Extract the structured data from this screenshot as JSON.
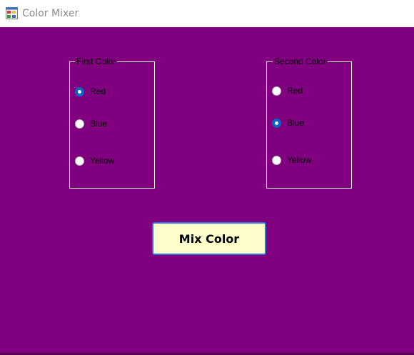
{
  "window": {
    "title": "Color Mixer",
    "icon": "app-window-icon"
  },
  "colors": {
    "client_background": "#800080",
    "button_background": "#ffffcc",
    "button_border": "#2f6fd8",
    "radio_checked": "#0b63c1"
  },
  "first_color": {
    "legend": "First Color",
    "options": [
      {
        "label": "Red",
        "checked": true
      },
      {
        "label": "Blue",
        "checked": false
      },
      {
        "label": "Yellow",
        "checked": false
      }
    ]
  },
  "second_color": {
    "legend": "Second Color",
    "options": [
      {
        "label": "Red",
        "checked": false
      },
      {
        "label": "Blue",
        "checked": true
      },
      {
        "label": "Yellow",
        "checked": false
      }
    ]
  },
  "mix_button": {
    "label": "Mix Color"
  }
}
